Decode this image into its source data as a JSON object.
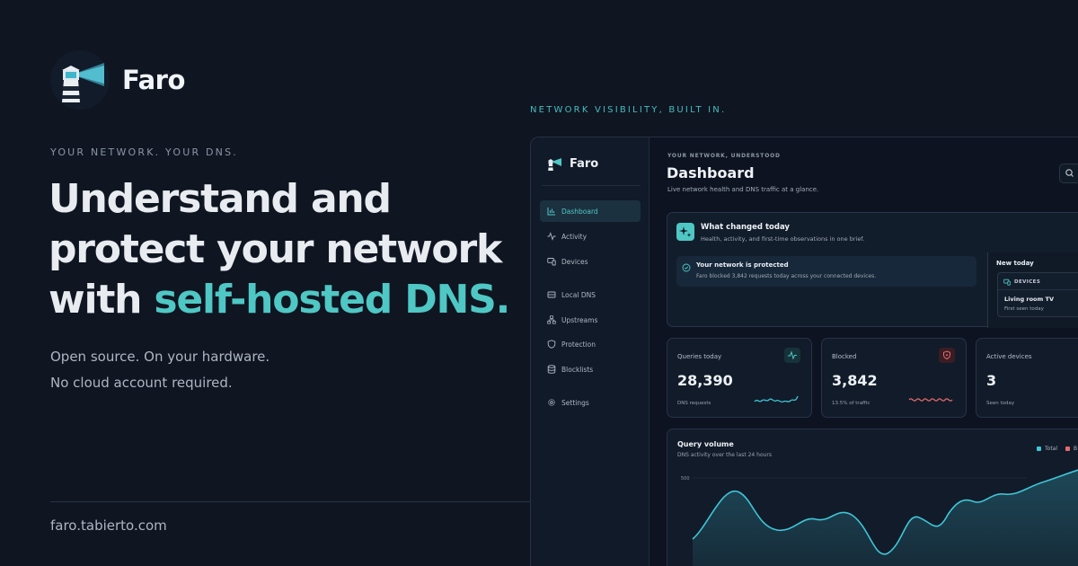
{
  "brand": {
    "name": "Faro"
  },
  "hero": {
    "eyebrow": "YOUR NETWORK. YOUR DNS.",
    "headline_line1": "Understand and",
    "headline_line2": "protect your network",
    "headline_line3_plain": "with ",
    "headline_line3_accent": "self-hosted DNS.",
    "sub_line1": "Open source. On your hardware.",
    "sub_line2": "No cloud account required.",
    "url": "faro.tabierto.com"
  },
  "preview": {
    "eyebrow": "NETWORK VISIBILITY, BUILT IN."
  },
  "colors": {
    "background": "#0f1521",
    "accent": "#4fc7c4",
    "danger": "#e46c6c"
  },
  "app": {
    "sidebar": {
      "brand": "Faro",
      "items": [
        {
          "label": "Dashboard",
          "icon": "bar-chart-icon",
          "active": true
        },
        {
          "label": "Activity",
          "icon": "activity-icon"
        },
        {
          "label": "Devices",
          "icon": "devices-icon"
        },
        {
          "label": "Local DNS",
          "icon": "server-icon"
        },
        {
          "label": "Upstreams",
          "icon": "network-icon"
        },
        {
          "label": "Protection",
          "icon": "shield-icon"
        },
        {
          "label": "Blocklists",
          "icon": "database-icon"
        },
        {
          "label": "Settings",
          "icon": "gear-icon"
        }
      ]
    },
    "header": {
      "eyebrow": "YOUR NETWORK, UNDERSTOOD",
      "title": "Dashboard",
      "subtitle": "Live network health and DNS traffic at a glance."
    },
    "changed": {
      "title": "What changed today",
      "subtitle": "Health, activity, and first-time observations in one brief.",
      "protected_title": "Your network is protected",
      "protected_text": "Faro blocked 3,842 requests today across your connected devices.",
      "new_today": {
        "title": "New today",
        "section": "DEVICES",
        "device": "Living room TV",
        "seen": "First seen today"
      }
    },
    "stats": [
      {
        "label": "Queries today",
        "value": "28,390",
        "note": "DNS requests",
        "icon": "activity-icon"
      },
      {
        "label": "Blocked",
        "value": "3,842",
        "note": "13.5% of traffic",
        "icon": "shield-icon"
      },
      {
        "label": "Active devices",
        "value": "3",
        "note": "Seen today"
      }
    ]
  },
  "chart_data": {
    "type": "area",
    "title": "Query volume",
    "subtitle": "DNS activity over the last 24 hours",
    "series": [
      {
        "name": "Total",
        "color": "#3ec6d8"
      },
      {
        "name": "B",
        "color": "#e46c6c"
      }
    ],
    "ytick_labels": [
      "500"
    ]
  }
}
